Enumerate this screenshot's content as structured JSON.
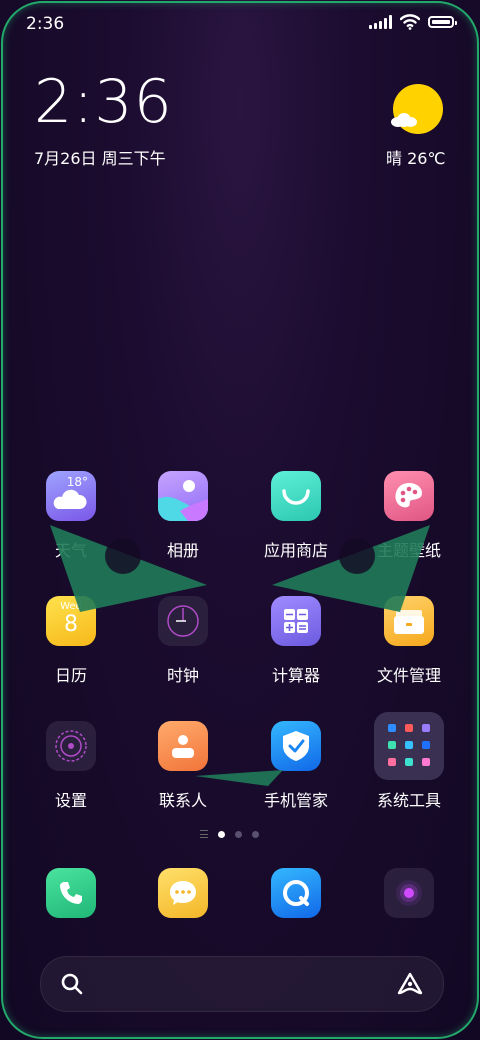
{
  "status_bar": {
    "time": "2:36"
  },
  "clock_widget": {
    "time": "2:36",
    "date": "7月26日 周三下午"
  },
  "weather_widget": {
    "text": "晴 26℃"
  },
  "apps": {
    "weather": {
      "label": "天气",
      "temp": "18°"
    },
    "gallery": {
      "label": "相册"
    },
    "app_store": {
      "label": "应用商店"
    },
    "themes": {
      "label": "主题壁纸"
    },
    "calendar": {
      "label": "日历",
      "weekday": "Wed",
      "day": "8"
    },
    "clock": {
      "label": "时钟"
    },
    "calculator": {
      "label": "计算器"
    },
    "file_manager": {
      "label": "文件管理"
    },
    "settings": {
      "label": "设置"
    },
    "contacts": {
      "label": "联系人"
    },
    "phone_manager": {
      "label": "手机管家"
    },
    "system_tools": {
      "label": "系统工具"
    }
  },
  "pager": {
    "pages": 3,
    "active": 1
  },
  "dock": [
    "phone-icon",
    "messages-icon",
    "browser-icon",
    "camera-icon"
  ],
  "search": {
    "left_icon": "search-icon",
    "right_icon": "assistant-icon"
  },
  "colors": {
    "bezel": "#22a86a",
    "sun": "#ffd200",
    "arrow": "#1f7a58"
  }
}
